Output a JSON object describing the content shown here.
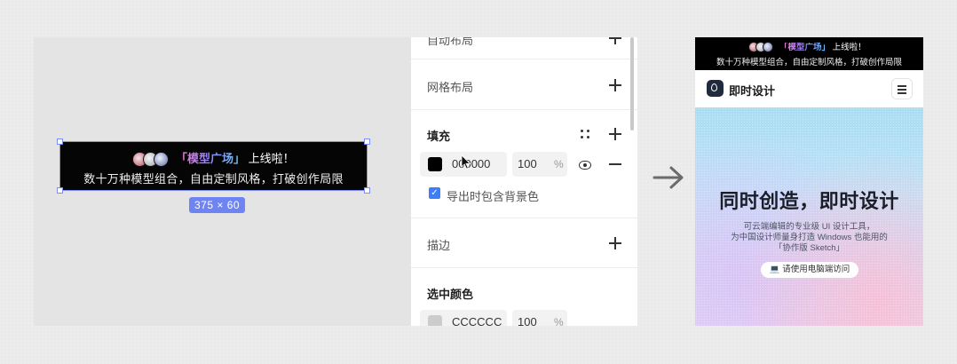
{
  "editor": {
    "banner": {
      "highlight": "「模型广场」",
      "line1_suffix": "上线啦！",
      "line2": "数十万种模型组合，自由定制风格，打破创作局限"
    },
    "dimension_label": "375 × 60"
  },
  "panel": {
    "partial_top_label": "自动布局",
    "grid_layout_label": "网格布局",
    "fill": {
      "title": "填充",
      "hex_value": "000000",
      "opacity": "100",
      "percent_sign": "%",
      "swatch_color": "#000000",
      "checkbox_label": "导出时包含背景色"
    },
    "stroke_label": "描边",
    "selection_colors": {
      "title": "选中颜色",
      "hex_value": "CCCCCC",
      "opacity": "100",
      "percent_sign": "%",
      "swatch_color": "#cccccc"
    }
  },
  "preview": {
    "banner": {
      "highlight": "「模型广场」",
      "line1_suffix": "上线啦！",
      "line2": "数十万种模型组合，自由定制风格，打破创作局限"
    },
    "brand_name": "即时设计",
    "hero_title": "同时创造，即时设计",
    "hero_sub_lines": [
      "可云端编辑的专业级 UI 设计工具，",
      "为中国设计师量身打造 Windows 也能用的",
      "「协作版 Sketch」"
    ],
    "cta_label": "请使用电脑端访问"
  },
  "colors": {
    "selection_accent": "#6f84f3",
    "checkbox_blue": "#3c7ef6"
  }
}
